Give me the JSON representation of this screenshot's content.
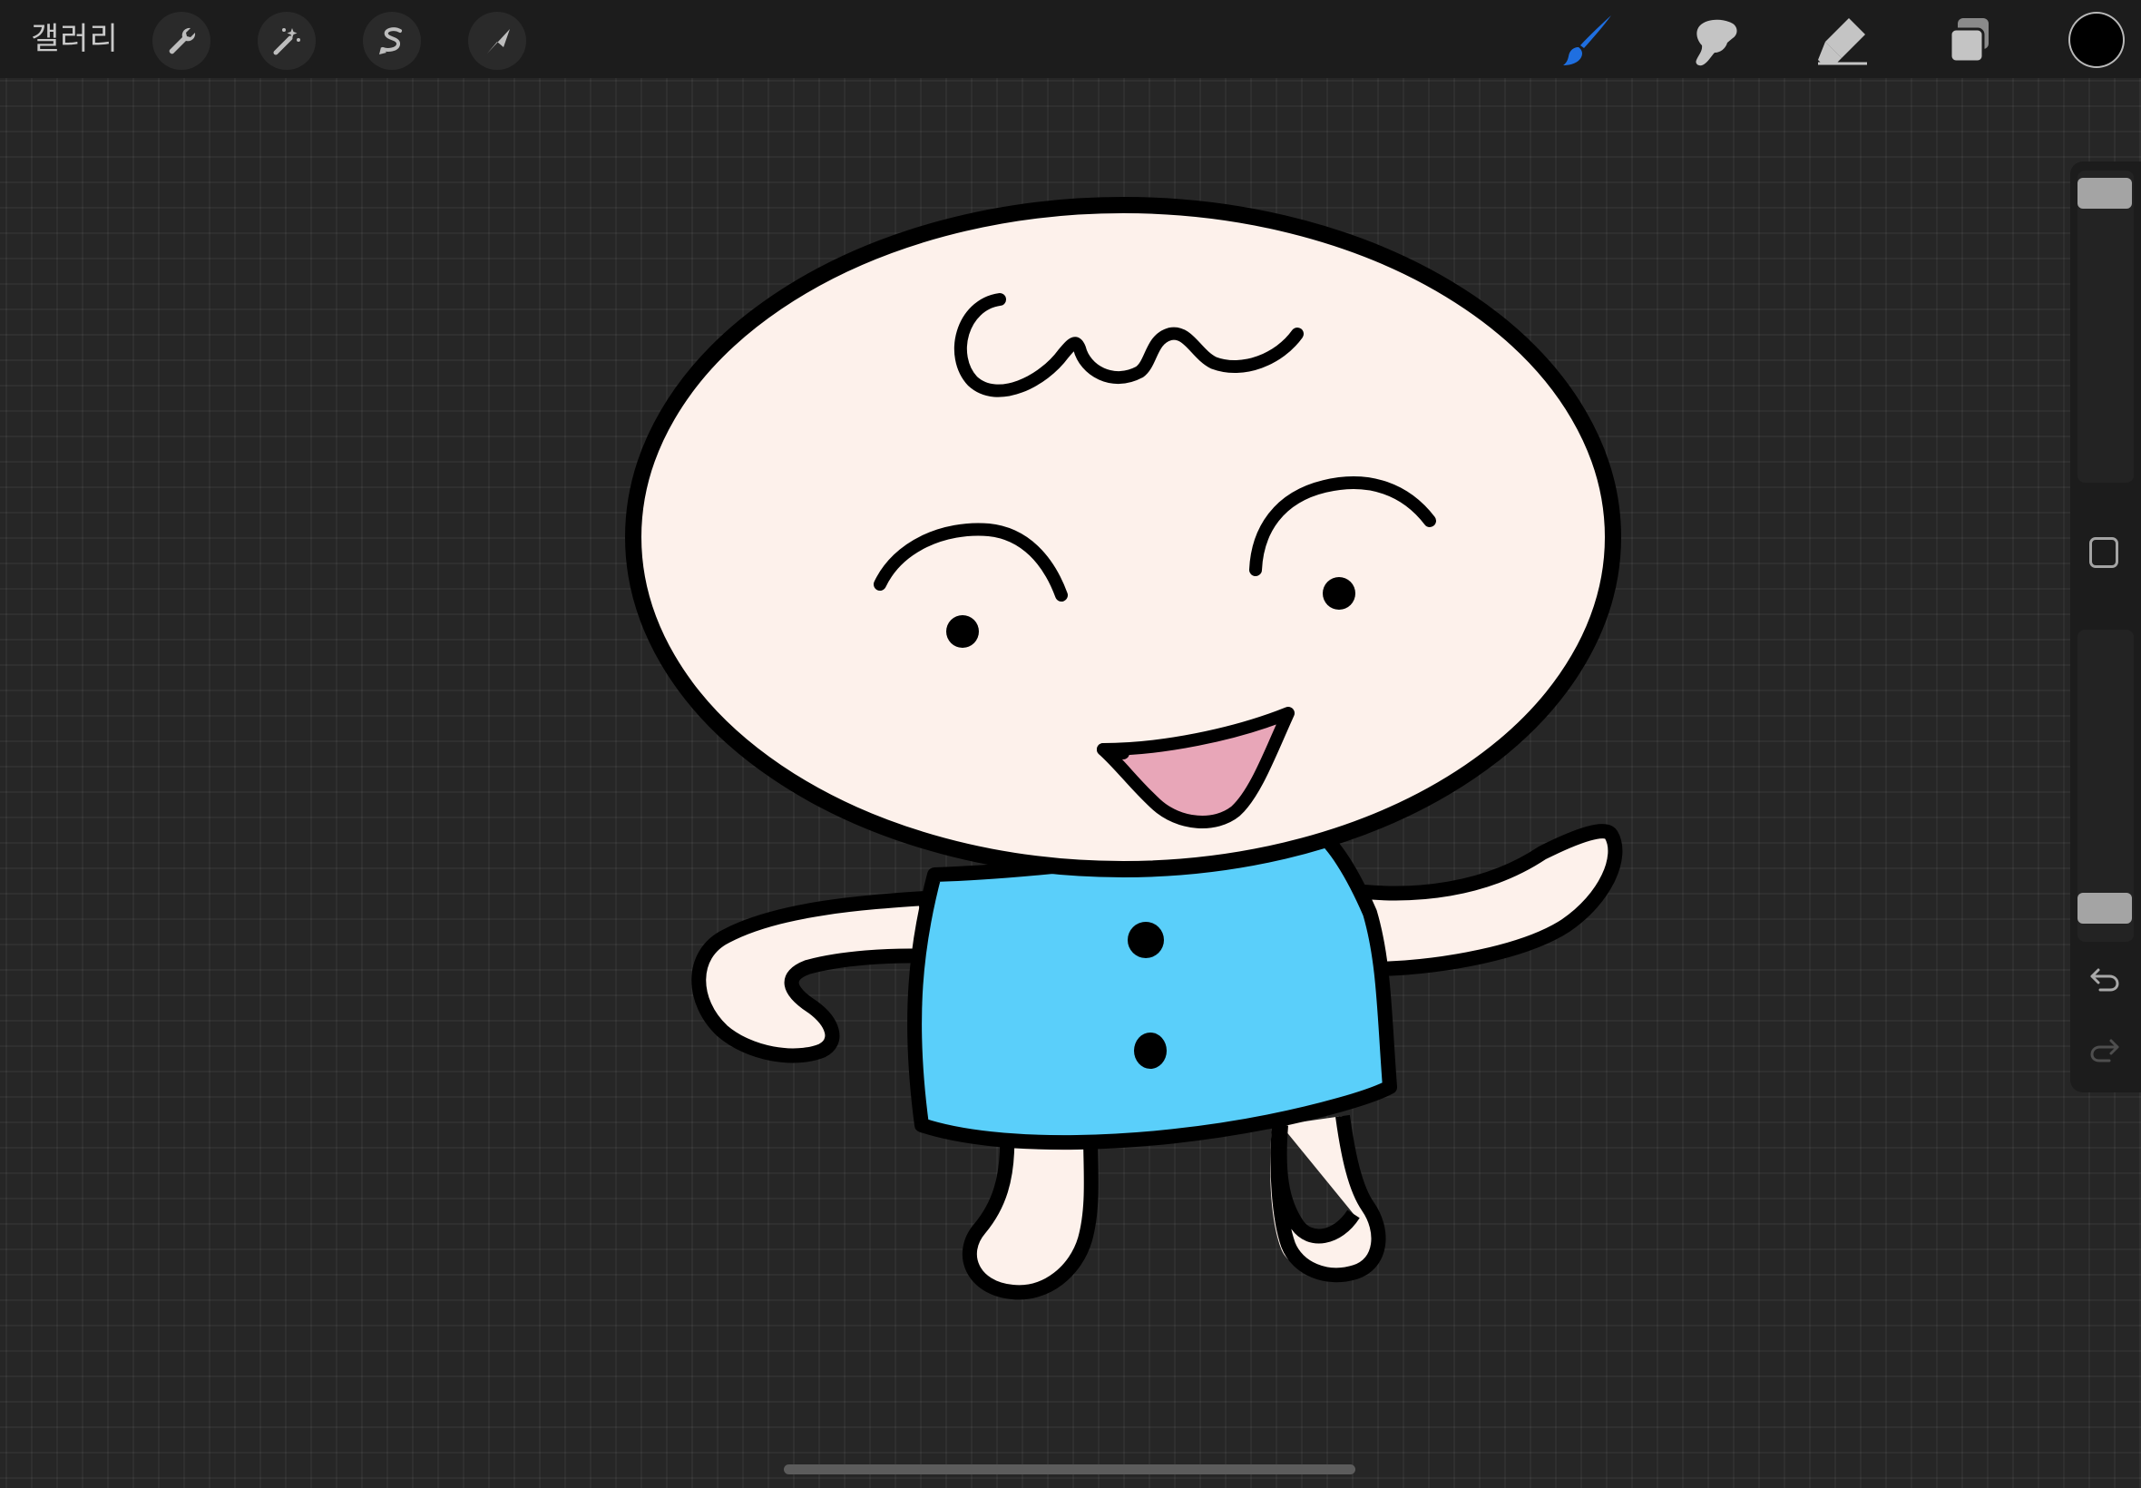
{
  "toolbar": {
    "gallery_label": "갤러리",
    "left_tools": [
      "wrench-icon",
      "magic-wand-icon",
      "selection-icon",
      "transform-arrow-icon"
    ],
    "right_tools": [
      "brush-icon",
      "smudge-icon",
      "eraser-icon",
      "layers-icon"
    ],
    "active_tool": "brush",
    "active_color": "#1f6fe0",
    "current_color": "#000000"
  },
  "sidebar": {
    "size_level": 0.0,
    "opacity_level": 1.0,
    "modify_icon": "square-modify-icon",
    "undo_icon": "undo-icon",
    "redo_icon": "redo-icon"
  },
  "artwork": {
    "description_colors": {
      "skin": "#fdf1eb",
      "shirt": "#5acffa",
      "tongue": "#e8a6b8",
      "outline": "#000000"
    }
  }
}
